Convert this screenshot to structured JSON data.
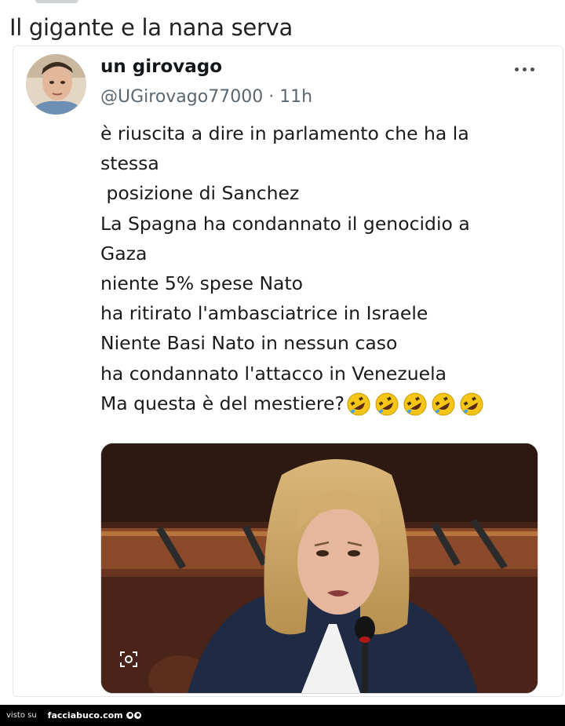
{
  "page": {
    "title": "Il gigante e la nana serva"
  },
  "tweet": {
    "author_name": "un girovago",
    "handle": "@UGirovago77000",
    "separator": " · ",
    "time": "11h",
    "more_icon": "more-horizontal-icon",
    "lines": [
      "è riuscita a dire in parlamento che ha la",
      "stessa",
      " posizione di Sanchez",
      "La Spagna ha condannato il genocidio a",
      "Gaza",
      "niente 5% spese Nato",
      "ha ritirato l'ambasciatrice in Israele",
      "Niente Basi Nato in nessun caso",
      "ha condannato l'attacco in Venezuela"
    ],
    "last_line": "Ma questa è del mestiere?",
    "emoji": [
      "rolling-on-floor-laughing-emoji",
      "rolling-on-floor-laughing-emoji",
      "rolling-on-floor-laughing-emoji",
      "rolling-on-floor-laughing-emoji",
      "rolling-on-floor-laughing-emoji"
    ],
    "media_alt_icon": "alt-text-icon"
  },
  "footer": {
    "visto_su": "visto su",
    "brand": "facciabuco.com"
  },
  "colors": {
    "handle": "#5b6770",
    "footer_bg": "#000000",
    "emoji_yellow": "#f5c518"
  }
}
